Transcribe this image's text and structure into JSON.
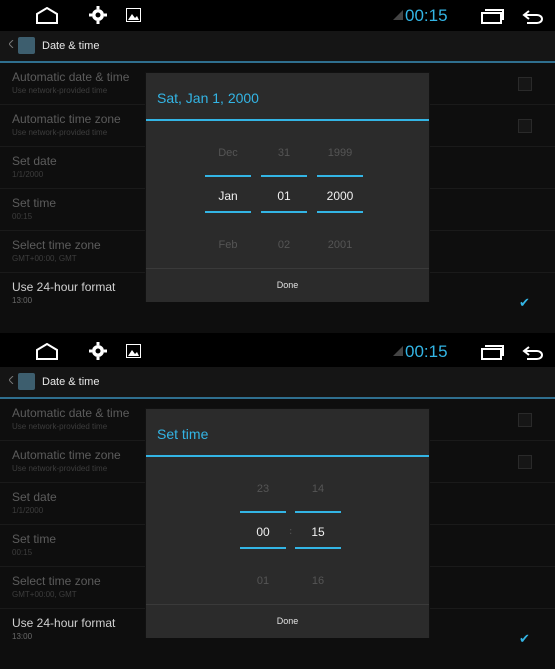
{
  "status": {
    "clock": "00:15",
    "icons": [
      "home-icon",
      "settings-icon",
      "gallery-icon",
      "signal-icon",
      "recent-apps-icon",
      "back-icon"
    ]
  },
  "actionbar": {
    "title": "Date & time",
    "icon": "settings-app-icon"
  },
  "settings": [
    {
      "title": "Automatic date & time",
      "summary": "Use network-provided time"
    },
    {
      "title": "Automatic time zone",
      "summary": "Use network-provided time"
    },
    {
      "title": "Set date",
      "summary": "1/1/2000"
    },
    {
      "title": "Set time",
      "summary": "00:15"
    },
    {
      "title": "Select time zone",
      "summary": "GMT+00:00, GMT"
    },
    {
      "title": "Use 24-hour format",
      "summary": "13:00"
    }
  ],
  "date_dialog": {
    "title": "Sat, Jan 1, 2000",
    "month": {
      "prev": "Dec",
      "current": "Jan",
      "next": "Feb"
    },
    "day": {
      "prev": "31",
      "current": "01",
      "next": "02"
    },
    "year": {
      "prev": "1999",
      "current": "2000",
      "next": "2001"
    },
    "done_label": "Done"
  },
  "time_dialog": {
    "title": "Set time",
    "hour": {
      "prev": "23",
      "current": "00",
      "next": "01"
    },
    "minute": {
      "prev": "14",
      "current": "15",
      "next": "16"
    },
    "separator": ":",
    "done_label": "Done"
  },
  "colors": {
    "accent": "#33b5e5",
    "dialog_bg": "#2b2b2b",
    "background": "#000000"
  }
}
